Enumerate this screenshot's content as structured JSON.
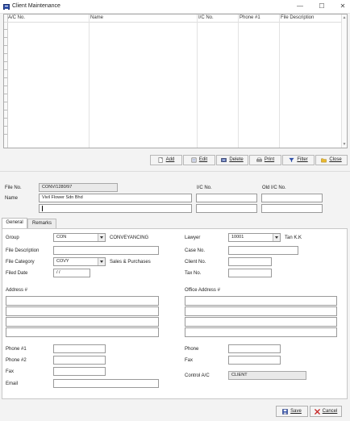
{
  "window": {
    "title": "Client Maintenance"
  },
  "grid": {
    "columns": [
      "A/C No.",
      "Name",
      "I/C No.",
      "Phone #1",
      "File Description"
    ]
  },
  "toolbar": {
    "add": "Add",
    "edit": "Edit",
    "delete": "Delete",
    "print": "Print",
    "filter": "Filter",
    "close": "Close"
  },
  "header": {
    "file_no_label": "File No.",
    "file_no_value": "CONV/1280/97",
    "name_label": "Name",
    "name_value": "Vivil Flower Sdn Bhd",
    "ic_no_label": "I/C No.",
    "old_ic_no_label": "Old I/C No."
  },
  "tabs": [
    "General",
    "Remarks"
  ],
  "general": {
    "group_label": "Group",
    "group_value": "CON",
    "group_desc": "CONVEYANCING",
    "file_description_label": "File Description",
    "file_category_label": "File Category",
    "file_category_value": "COVY",
    "file_category_desc": "Sales & Purchases",
    "filed_date_label": "Filed Date",
    "filed_date_value": "/ /",
    "lawyer_label": "Lawyer",
    "lawyer_value": "10001",
    "lawyer_desc": "Tan K.K",
    "case_no_label": "Case No.",
    "client_no_label": "Client No.",
    "tax_no_label": "Tax No.",
    "address_label": "Address #",
    "office_address_label": "Office Address #",
    "phone1_label": "Phone #1",
    "phone2_label": "Phone #2",
    "fax_label": "Fax",
    "email_label": "Email",
    "phone_label": "Phone",
    "fax2_label": "Fax",
    "control_ac_label": "Control A/C",
    "control_ac_value": "CLIENT"
  },
  "footer": {
    "save": "Save",
    "cancel": "Cancel"
  },
  "icons": [
    "app-icon",
    "minimize-icon",
    "maximize-icon",
    "close-icon",
    "add-icon",
    "edit-icon",
    "delete-icon",
    "print-icon",
    "filter-icon",
    "folder-close-icon",
    "save-icon",
    "cancel-icon"
  ],
  "colors": {
    "accent": "#2f4fa8",
    "cancel_red": "#c62828"
  }
}
